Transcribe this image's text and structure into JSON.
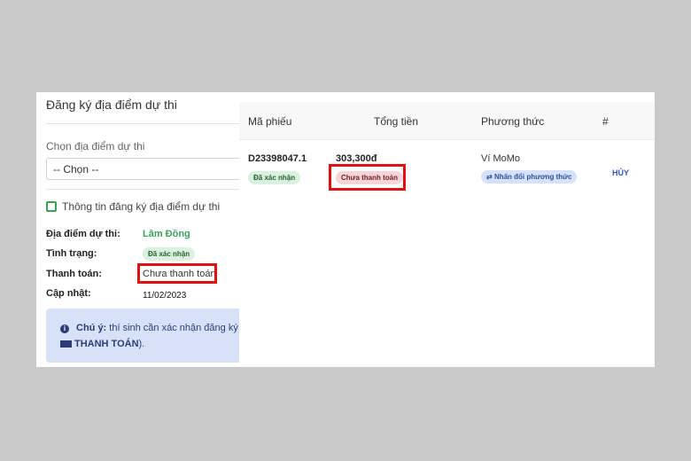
{
  "left": {
    "title": "Đăng ký địa điểm dự thi",
    "select_label": "Chọn địa điểm dự thi",
    "select_value": "-- Chọn --",
    "section_title": "Thông tin đăng ký địa điểm dự thi",
    "fields": [
      {
        "label": "Địa điểm dự thi:",
        "value": "Lâm Đồng"
      },
      {
        "label": "Tình trạng:",
        "value": "Đã xác nhận"
      },
      {
        "label": "Thanh toán:",
        "value": "Chưa thanh toán"
      },
      {
        "label": "Cập nhật:",
        "value": "11/02/2023"
      }
    ],
    "note": {
      "bold": "Chú ý:",
      "text": " thí sinh cần xác nhận đăng ký dự thi (tại mục",
      "link": "THANH TOÁN",
      "end": ")."
    }
  },
  "table": {
    "headers": [
      "Mã phiếu",
      "Tổng tiền",
      "Phương thức",
      "#"
    ],
    "row": {
      "code": "D23398047.1",
      "code_status": "Đã xác nhận",
      "amount": "303,300đ",
      "pay_status": "Chưa thanh toán",
      "method": "Ví MoMo",
      "change_method": "Nhấn đổi phương thức",
      "action": "HỦY"
    }
  },
  "colors": {
    "highlight": "#e01010",
    "green": "#3aa25a",
    "note_bg": "#d7e2f8"
  }
}
